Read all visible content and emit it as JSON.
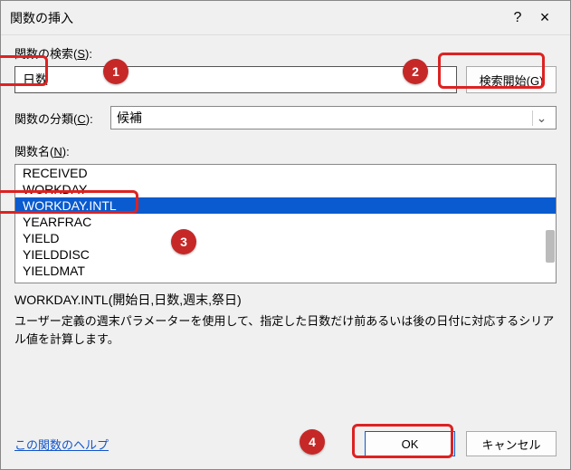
{
  "titlebar": {
    "title": "関数の挿入",
    "help": "?",
    "close": "×"
  },
  "search": {
    "label": "関数の検索(S):",
    "value": "日数",
    "button": "検索開始(G)"
  },
  "category": {
    "label": "関数の分類(C):",
    "value": "候補"
  },
  "funcname_label": "関数名(N):",
  "functions": {
    "items": [
      "RECEIVED",
      "WORKDAY",
      "WORKDAY.INTL",
      "YEARFRAC",
      "YIELD",
      "YIELDDISC",
      "YIELDMAT"
    ],
    "selected_index": 2
  },
  "description": {
    "signature": "WORKDAY.INTL(開始日,日数,週末,祭日)",
    "text": "ユーザー定義の週末パラメーターを使用して、指定した日数だけ前あるいは後の日付に対応するシリアル値を計算します。"
  },
  "footer": {
    "help_link": "この関数のヘルプ",
    "ok": "OK",
    "cancel": "キャンセル"
  },
  "annotations": {
    "b1": "1",
    "b2": "2",
    "b3": "3",
    "b4": "4"
  }
}
